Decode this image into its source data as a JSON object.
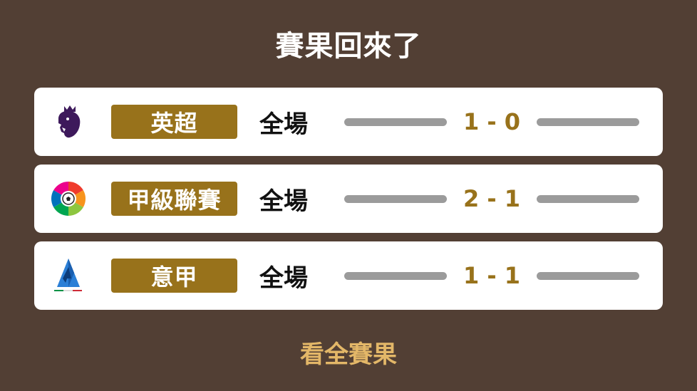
{
  "header": {
    "title": "賽果回來了"
  },
  "matches": [
    {
      "league": "英超",
      "logo_icon": "premier-league-lion-icon",
      "status": "全場",
      "score": "1 - 0"
    },
    {
      "league": "甲級聯賽",
      "logo_icon": "laliga-ball-icon",
      "status": "全場",
      "score": "2 - 1"
    },
    {
      "league": "意甲",
      "logo_icon": "serie-a-icon",
      "status": "全場",
      "score": "1 - 1"
    }
  ],
  "footer": {
    "view_all_label": "看全賽果"
  },
  "colors": {
    "background": "#523f34",
    "card": "#ffffff",
    "badge": "#98721b",
    "score": "#98721b",
    "bar": "#9b9b9b",
    "link": "#e3b768"
  }
}
